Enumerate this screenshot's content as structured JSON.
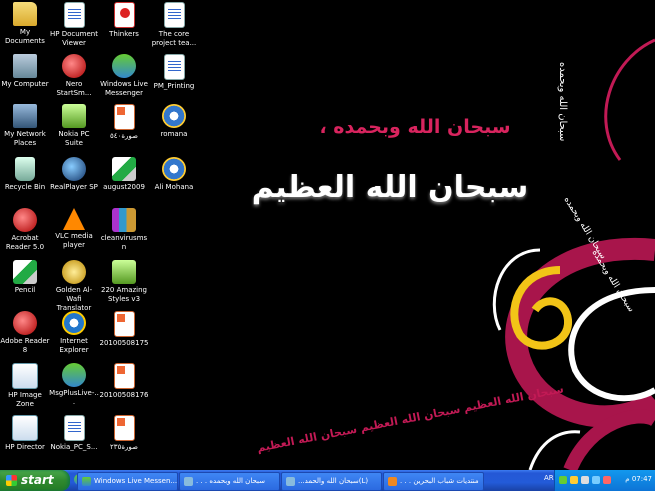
{
  "wallpaper": {
    "line1": "سبحان الله وبحمده ،",
    "line2": "سبحان الله العظيم",
    "curve_text": "سبحان الله العظيم سبحان الله العظيم سبحان الله العظيم",
    "vertical_text": "سبحان الله وبحمده",
    "diagonal_text": "سبحان الله وبحمده",
    "diagonal_text2": "سبحان الله وبحمده"
  },
  "icons": [
    {
      "label": "My Documents",
      "icon": "folder-icon"
    },
    {
      "label": "HP Document Viewer",
      "icon": "document-viewer-icon"
    },
    {
      "label": "Thinkers",
      "icon": "pdf-icon"
    },
    {
      "label": "The core project tea...",
      "icon": "word-document-icon"
    },
    {
      "label": "My Computer",
      "icon": "computer-icon"
    },
    {
      "label": "Nero StartSm...",
      "icon": "nero-icon"
    },
    {
      "label": "Windows Live Messenger",
      "icon": "messenger-icon"
    },
    {
      "label": "PM_Printing",
      "icon": "word-document-icon"
    },
    {
      "label": "My Network Places",
      "icon": "network-icon"
    },
    {
      "label": "Nokia PC Suite",
      "icon": "nokia-icon"
    },
    {
      "label": "صورة٥٤٠",
      "icon": "powerpoint-icon"
    },
    {
      "label": "romana",
      "icon": "media-file-icon"
    },
    {
      "label": "Recycle Bin",
      "icon": "recycle-bin-icon"
    },
    {
      "label": "RealPlayer SP",
      "icon": "realplayer-icon"
    },
    {
      "label": "august2009",
      "icon": "image-file-icon"
    },
    {
      "label": "Ali Mohana",
      "icon": "media-file-icon"
    },
    {
      "label": "Acrobat Reader 5.0",
      "icon": "acrobat-icon"
    },
    {
      "label": "VLC media player",
      "icon": "vlc-cone-icon"
    },
    {
      "label": "cleanvirusmsn",
      "icon": "archive-icon"
    },
    {
      "label": "Pencil",
      "icon": "pencil-icon"
    },
    {
      "label": "Golden Al-Wafi Translator",
      "icon": "translator-icon"
    },
    {
      "label": "220 Amazing Styles v3",
      "icon": "image-file-icon"
    },
    {
      "label": "Adobe Reader 8",
      "icon": "adobe-reader-icon"
    },
    {
      "label": "Internet Explorer",
      "icon": "internet-explorer-icon"
    },
    {
      "label": "20100508175",
      "icon": "powerpoint-icon"
    },
    {
      "label": "HP Image Zone",
      "icon": "hp-image-zone-icon"
    },
    {
      "label": "MsgPlusLive-...",
      "icon": "msgplus-icon"
    },
    {
      "label": "20100508176",
      "icon": "powerpoint-icon"
    },
    {
      "label": "HP Director",
      "icon": "hp-director-icon"
    },
    {
      "label": "Nokia_PC_S...",
      "icon": "installer-icon"
    },
    {
      "label": "صورة٢٣٥",
      "icon": "powerpoint-icon"
    }
  ],
  "taskbar": {
    "start_label": "start",
    "tasks": [
      {
        "label": "Windows Live Messen...",
        "icon": "messenger-icon"
      },
      {
        "label": "سبحان الله وبحمده . . .",
        "icon": "messenger-chat-icon"
      },
      {
        "label": "(L)سبحان الله والحمد...",
        "icon": "messenger-chat-icon"
      },
      {
        "label": "منتديات شباب البحرين . . .",
        "icon": "browser-icon"
      }
    ],
    "language": "AR",
    "clock": "07:47 م"
  }
}
